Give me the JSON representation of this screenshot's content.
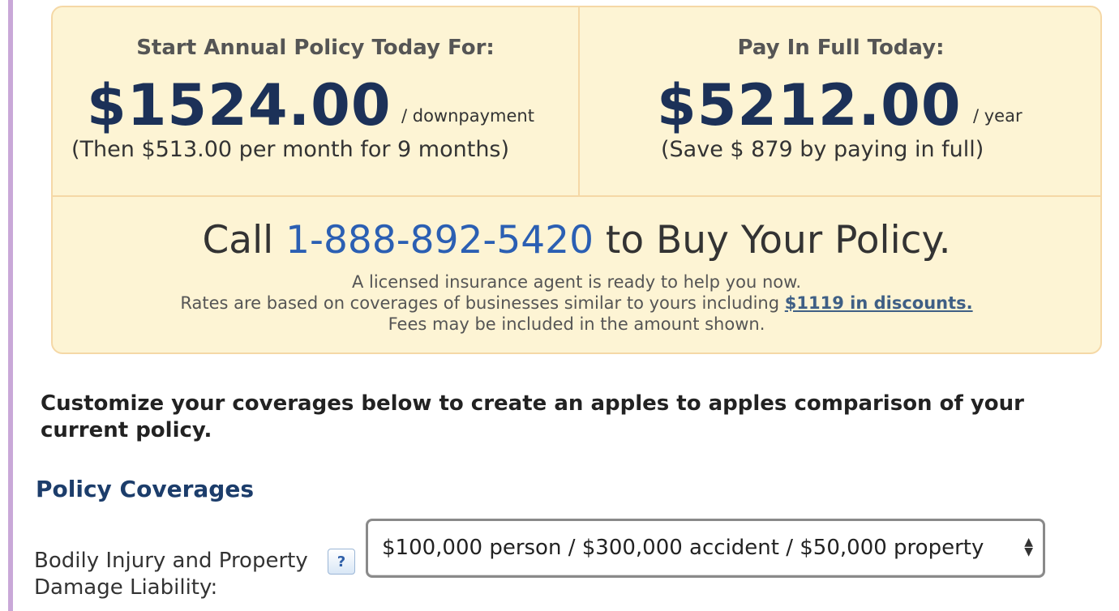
{
  "quote": {
    "annual": {
      "title": "Start Annual Policy Today For:",
      "amount": "$1524.00",
      "unit": "/ downpayment",
      "detail": "(Then $513.00  per month for 9  months)"
    },
    "full": {
      "title": "Pay In Full Today:",
      "amount": "$5212.00",
      "unit": "/ year",
      "detail": "(Save $ 879  by paying in full)"
    },
    "call": {
      "prefix": "Call",
      "phone": "1-888-892-5420",
      "suffix": "to Buy Your Policy."
    },
    "notes": {
      "agent": "A licensed insurance agent is ready to help you now.",
      "rates_prefix": "Rates are based on coverages of businesses similar to yours including",
      "discount_link": "$1119 in discounts.",
      "fees": "Fees may be included in the amount shown."
    }
  },
  "customize_text": "Customize your coverages below to create an apples to apples comparison of your current policy.",
  "coverages": {
    "heading": "Policy Coverages",
    "bodily_injury": {
      "label": "Bodily Injury and Property Damage Liability:",
      "help": "?",
      "selected": "$100,000 person / $300,000 accident / $50,000 property"
    }
  },
  "colors": {
    "panel_bg": "#fdf4d4",
    "panel_border": "#f5d8a6",
    "amount": "#1c3158",
    "phone": "#2b5fb3",
    "heading": "#1c3d6b"
  },
  "icons": {
    "help": "question-mark-icon",
    "select_arrows": "up-down-arrows-icon"
  }
}
